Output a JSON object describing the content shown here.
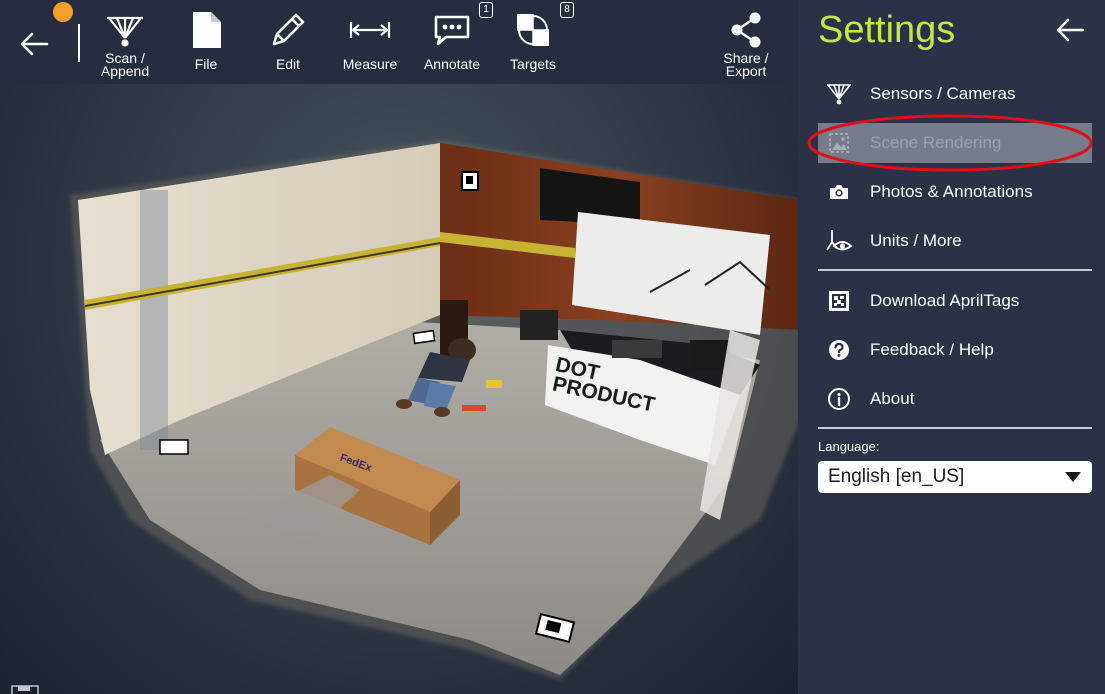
{
  "colors": {
    "toolbar_bg": "#262d3e",
    "panel_bg": "#2b3147",
    "accent_title": "#c6e641",
    "notification_dot": "#f0a02a",
    "highlight_bg": "#777c8a",
    "annotation_circle": "#e0101a"
  },
  "toolbar": {
    "back_icon": "arrow-left-icon",
    "items": [
      {
        "label": "Scan /\nAppend",
        "icon": "scan-sensor-icon"
      },
      {
        "label": "File",
        "icon": "file-icon"
      },
      {
        "label": "Edit",
        "icon": "pencil-icon"
      },
      {
        "label": "Measure",
        "icon": "measure-icon"
      },
      {
        "label": "Annotate",
        "icon": "speech-bubble-icon",
        "badge": "1"
      },
      {
        "label": "Targets",
        "icon": "target-icon",
        "badge": "8"
      },
      {
        "label": "Share /\nExport",
        "icon": "share-icon"
      }
    ]
  },
  "settings": {
    "title": "Settings",
    "back_icon": "arrow-left-icon",
    "menu": [
      {
        "label": "Sensors / Cameras",
        "icon": "sensor-icon"
      },
      {
        "label": "Scene Rendering",
        "icon": "scene-icon",
        "highlighted": true
      },
      {
        "label": "Photos & Annotations",
        "icon": "camera-icon"
      },
      {
        "label": "Units / More",
        "icon": "units-eye-icon"
      },
      {
        "label": "Download AprilTags",
        "icon": "apriltag-icon"
      },
      {
        "label": "Feedback / Help",
        "icon": "help-icon"
      },
      {
        "label": "About",
        "icon": "info-icon"
      }
    ],
    "language": {
      "label": "Language:",
      "selected": "English [en_US]"
    }
  },
  "scene": {
    "box_text": "FedEx",
    "banner_text_line1": "DOT",
    "banner_text_line2": "PRODUCT"
  }
}
